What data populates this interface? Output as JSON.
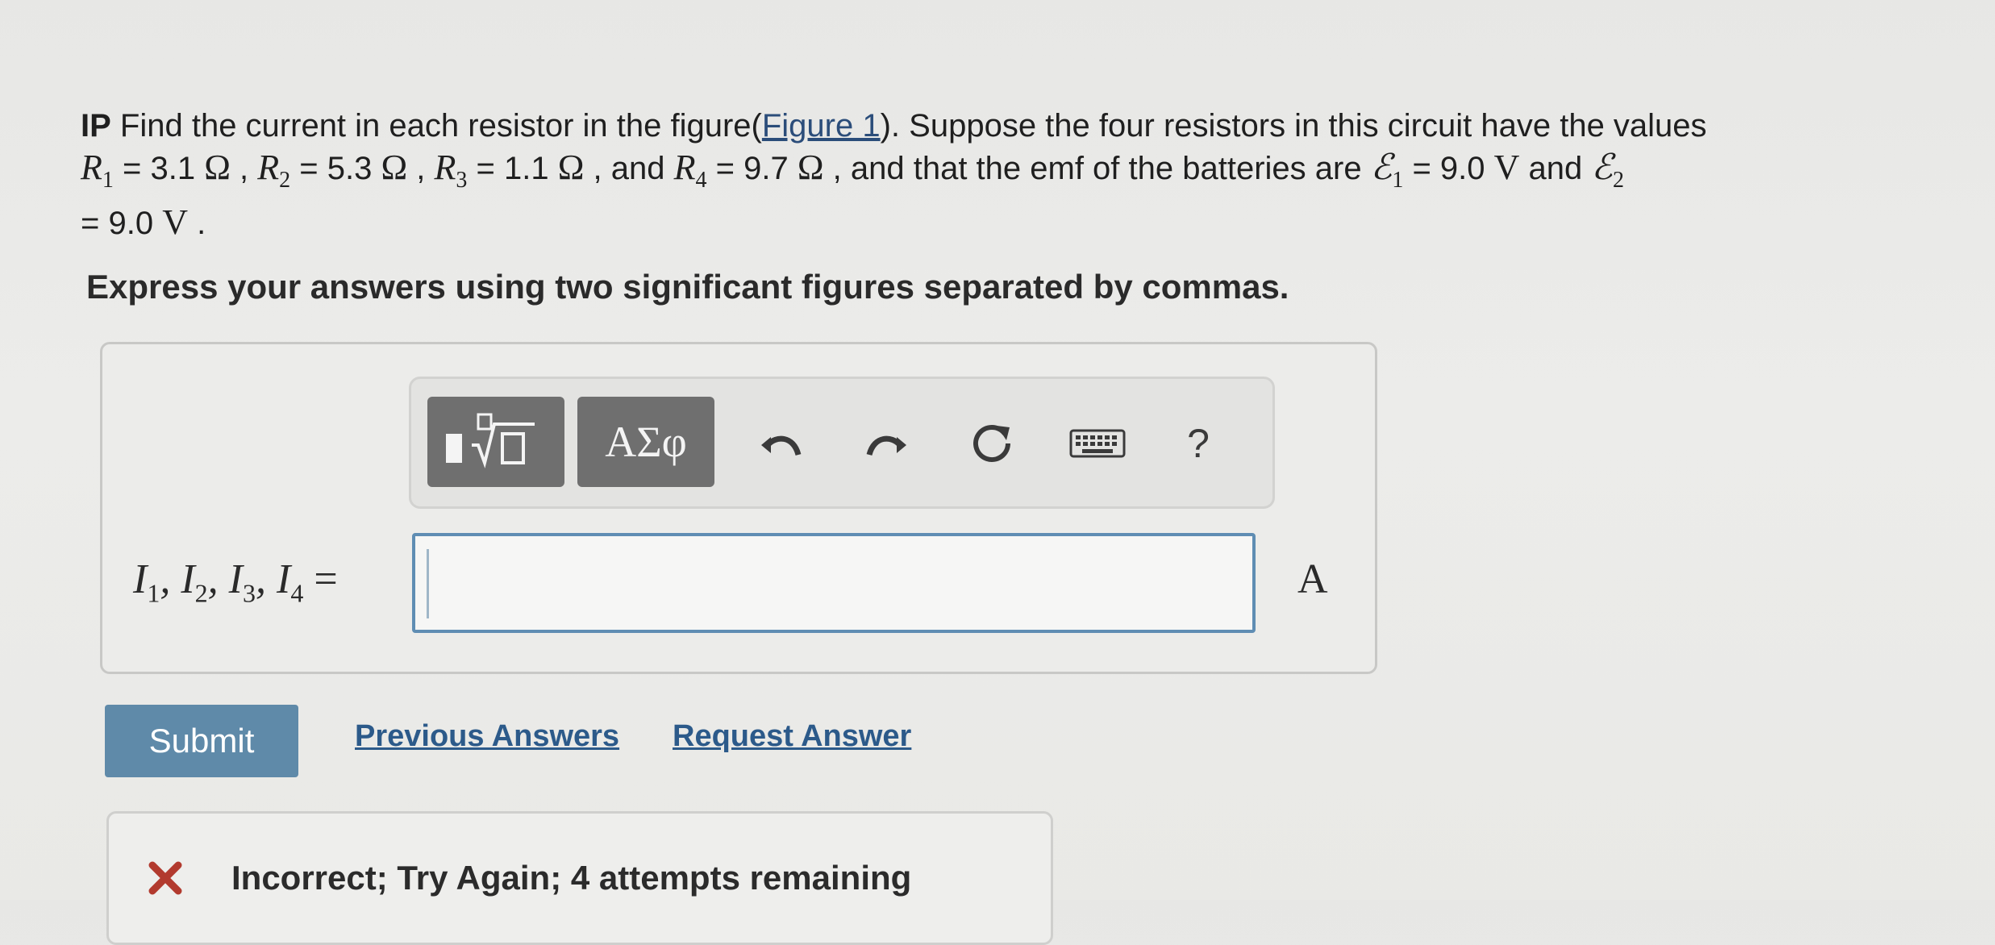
{
  "problem": {
    "prefix": "IP",
    "text_before_link": " Find the current in each resistor in the figure(",
    "figure_link": "Figure 1",
    "text_after_link": "). Suppose the four resistors in this circuit have the values",
    "r1_symbol": "R",
    "r1_sub": "1",
    "r1_value": " = 3.1 ",
    "r2_symbol": "R",
    "r2_sub": "2",
    "r2_value": " = 5.3 ",
    "r3_symbol": "R",
    "r3_sub": "3",
    "r3_value": " = 1.1 ",
    "and_word": " , and ",
    "r4_symbol": "R",
    "r4_sub": "4",
    "r4_value": " = 9.7 ",
    "ohm": "Ω",
    "separator": " , ",
    "emf_text": " , and that the emf of the batteries are ",
    "e1_symbol": "ℰ",
    "e1_sub": "1",
    "e1_value": " = 9.0 ",
    "volt": "V",
    "and_text": " and ",
    "e2_symbol": "ℰ",
    "e2_sub": "2",
    "e2_value": "= 9.0 ",
    "period": " ."
  },
  "instructions": "Express your answers using two significant figures separated by commas.",
  "toolbar": {
    "templates_icon": "templates-icon",
    "greek_label": "ΑΣφ",
    "undo_icon": "undo-icon",
    "redo_icon": "redo-icon",
    "reset_icon": "reset-icon",
    "keyboard_icon": "keyboard-icon",
    "help_label": "?"
  },
  "equation": {
    "symbol": "I",
    "sub1": "1",
    "sub2": "2",
    "sub3": "3",
    "sub4": "4",
    "comma": ", ",
    "equals": " ="
  },
  "answer": {
    "value": "",
    "unit": "A"
  },
  "buttons": {
    "submit": "Submit"
  },
  "links": {
    "previous_answers": "Previous Answers",
    "request_answer": "Request Answer"
  },
  "feedback": {
    "icon": "x-icon",
    "text": "Incorrect; Try Again; 4 attempts remaining",
    "icon_color": "#b23a2e"
  }
}
